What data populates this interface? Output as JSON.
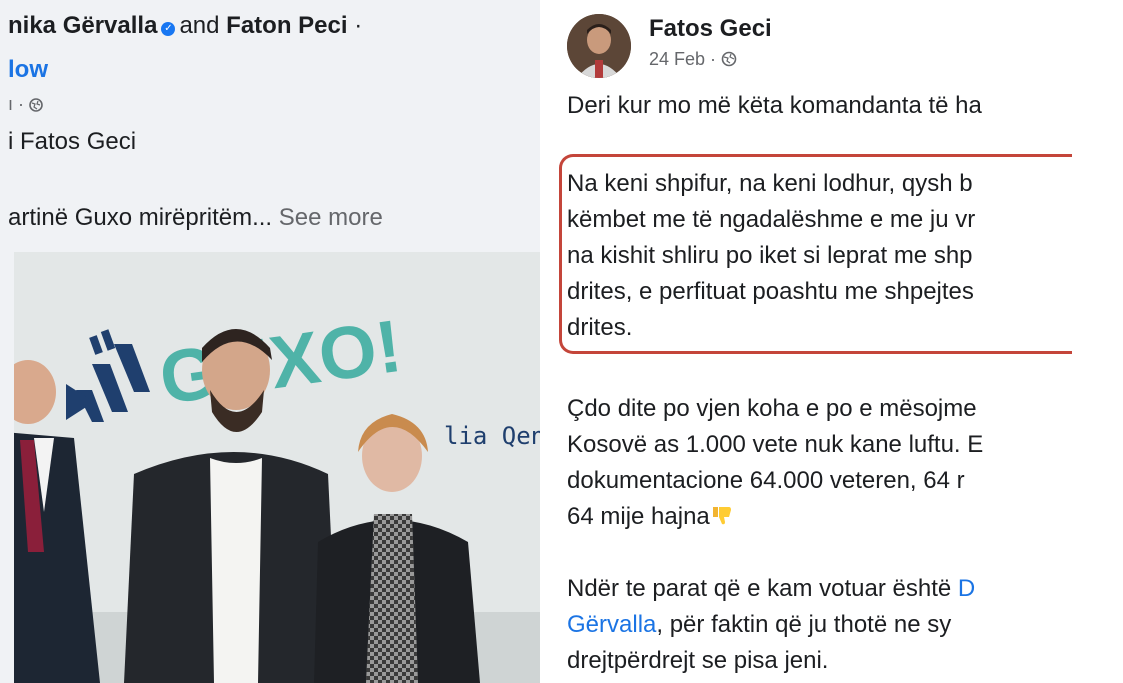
{
  "left_post": {
    "author_1": "nika Gërvalla",
    "and_text": "and",
    "author_2": "Faton Peci",
    "separator": "·",
    "follow_label": "low",
    "meta": "ı · ",
    "tag_text": "i Fatos Geci",
    "preview_text": "artinë Guxo mirëpritëm...",
    "see_more_label": "See more",
    "photo": {
      "logo_text": "GUXO!",
      "banner_text": "lia Qend"
    }
  },
  "right_post": {
    "author": "Fatos Geci",
    "date": "24 Feb · ",
    "paragraph_1": "Deri kur mo më këta komandanta të ha",
    "boxed_lines": [
      "Na keni shpifur, na keni lodhur, qysh b",
      "këmbet me të ngadalëshme e me ju vr",
      "na kishit shliru po iket si leprat me shp",
      "drites, e perfituat poashtu me shpejtes",
      "drites."
    ],
    "paragraph_3_lines": [
      "Çdo dite po vjen koha e po e mësojme",
      "Kosovë as 1.000 vete nuk kane luftu. E",
      "dokumentacione 64.000 veteren, 64 r",
      "64 mije hajna"
    ],
    "paragraph_4_line1_text": "Ndër te parat që e kam votuar është ",
    "paragraph_4_mention_1": "D",
    "paragraph_4_mention_2": "Gërvalla",
    "paragraph_4_line2_rest": ", për faktin që ju thotë ne sy",
    "paragraph_4_line3": "drejtpërdrejt se pisa jeni."
  },
  "icons": {
    "verified": "verified-badge-icon",
    "globe": "globe-icon",
    "thumbs_down": "thumbs-down-emoji"
  },
  "colors": {
    "link_blue": "#1b74e4",
    "highlight_box": "#c4453a",
    "guxo_teal": "#4fb3a8",
    "guxo_navy": "#1f3f6e",
    "secondary_text": "#65676b"
  }
}
